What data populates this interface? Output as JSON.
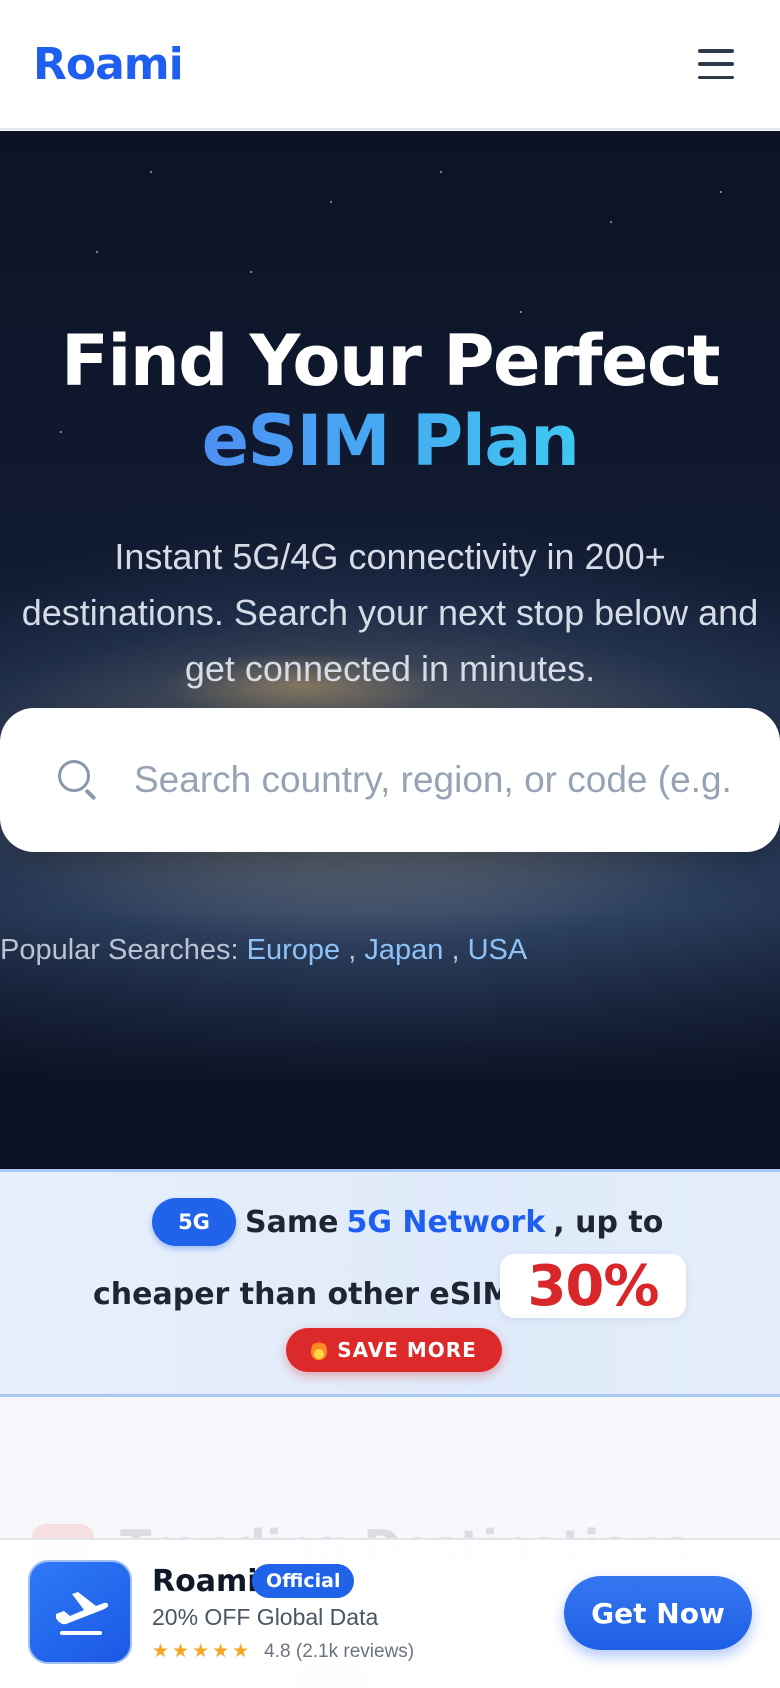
{
  "header": {
    "logo": "Roami",
    "menu_icon": "hamburger-menu-icon"
  },
  "hero": {
    "title_line1": "Find Your Perfect",
    "title_line2": "eSIM Plan",
    "subtitle": "Instant 5G/4G connectivity in 200+ destinations. Search your next stop below and get connected in minutes.",
    "search": {
      "placeholder": "Search country, region, or code (e.g. FR, US)",
      "value": ""
    },
    "popular": {
      "label": "Popular Searches:",
      "items": [
        "Europe",
        "Japan",
        "USA"
      ],
      "separator": ","
    }
  },
  "promo": {
    "badge": "5G",
    "line1_prefix": "Same",
    "line1_highlight": "5G Network",
    "line1_suffix": ", up to",
    "line2": "cheaper than other eSIMs",
    "percent": "30%",
    "save_button": "SAVE MORE",
    "colors": {
      "accent": "#1e5ff0",
      "highlight": "#d8262b"
    }
  },
  "trending": {
    "heading": "Trending Destinations"
  },
  "app_banner": {
    "name": "Roami",
    "badge": "Official",
    "tagline": "20% OFF Global Data",
    "stars": "★★★★★",
    "rating_text": "4.8 (2.1k reviews)",
    "cta": "Get Now",
    "icon": "airplane-takeoff-icon"
  }
}
